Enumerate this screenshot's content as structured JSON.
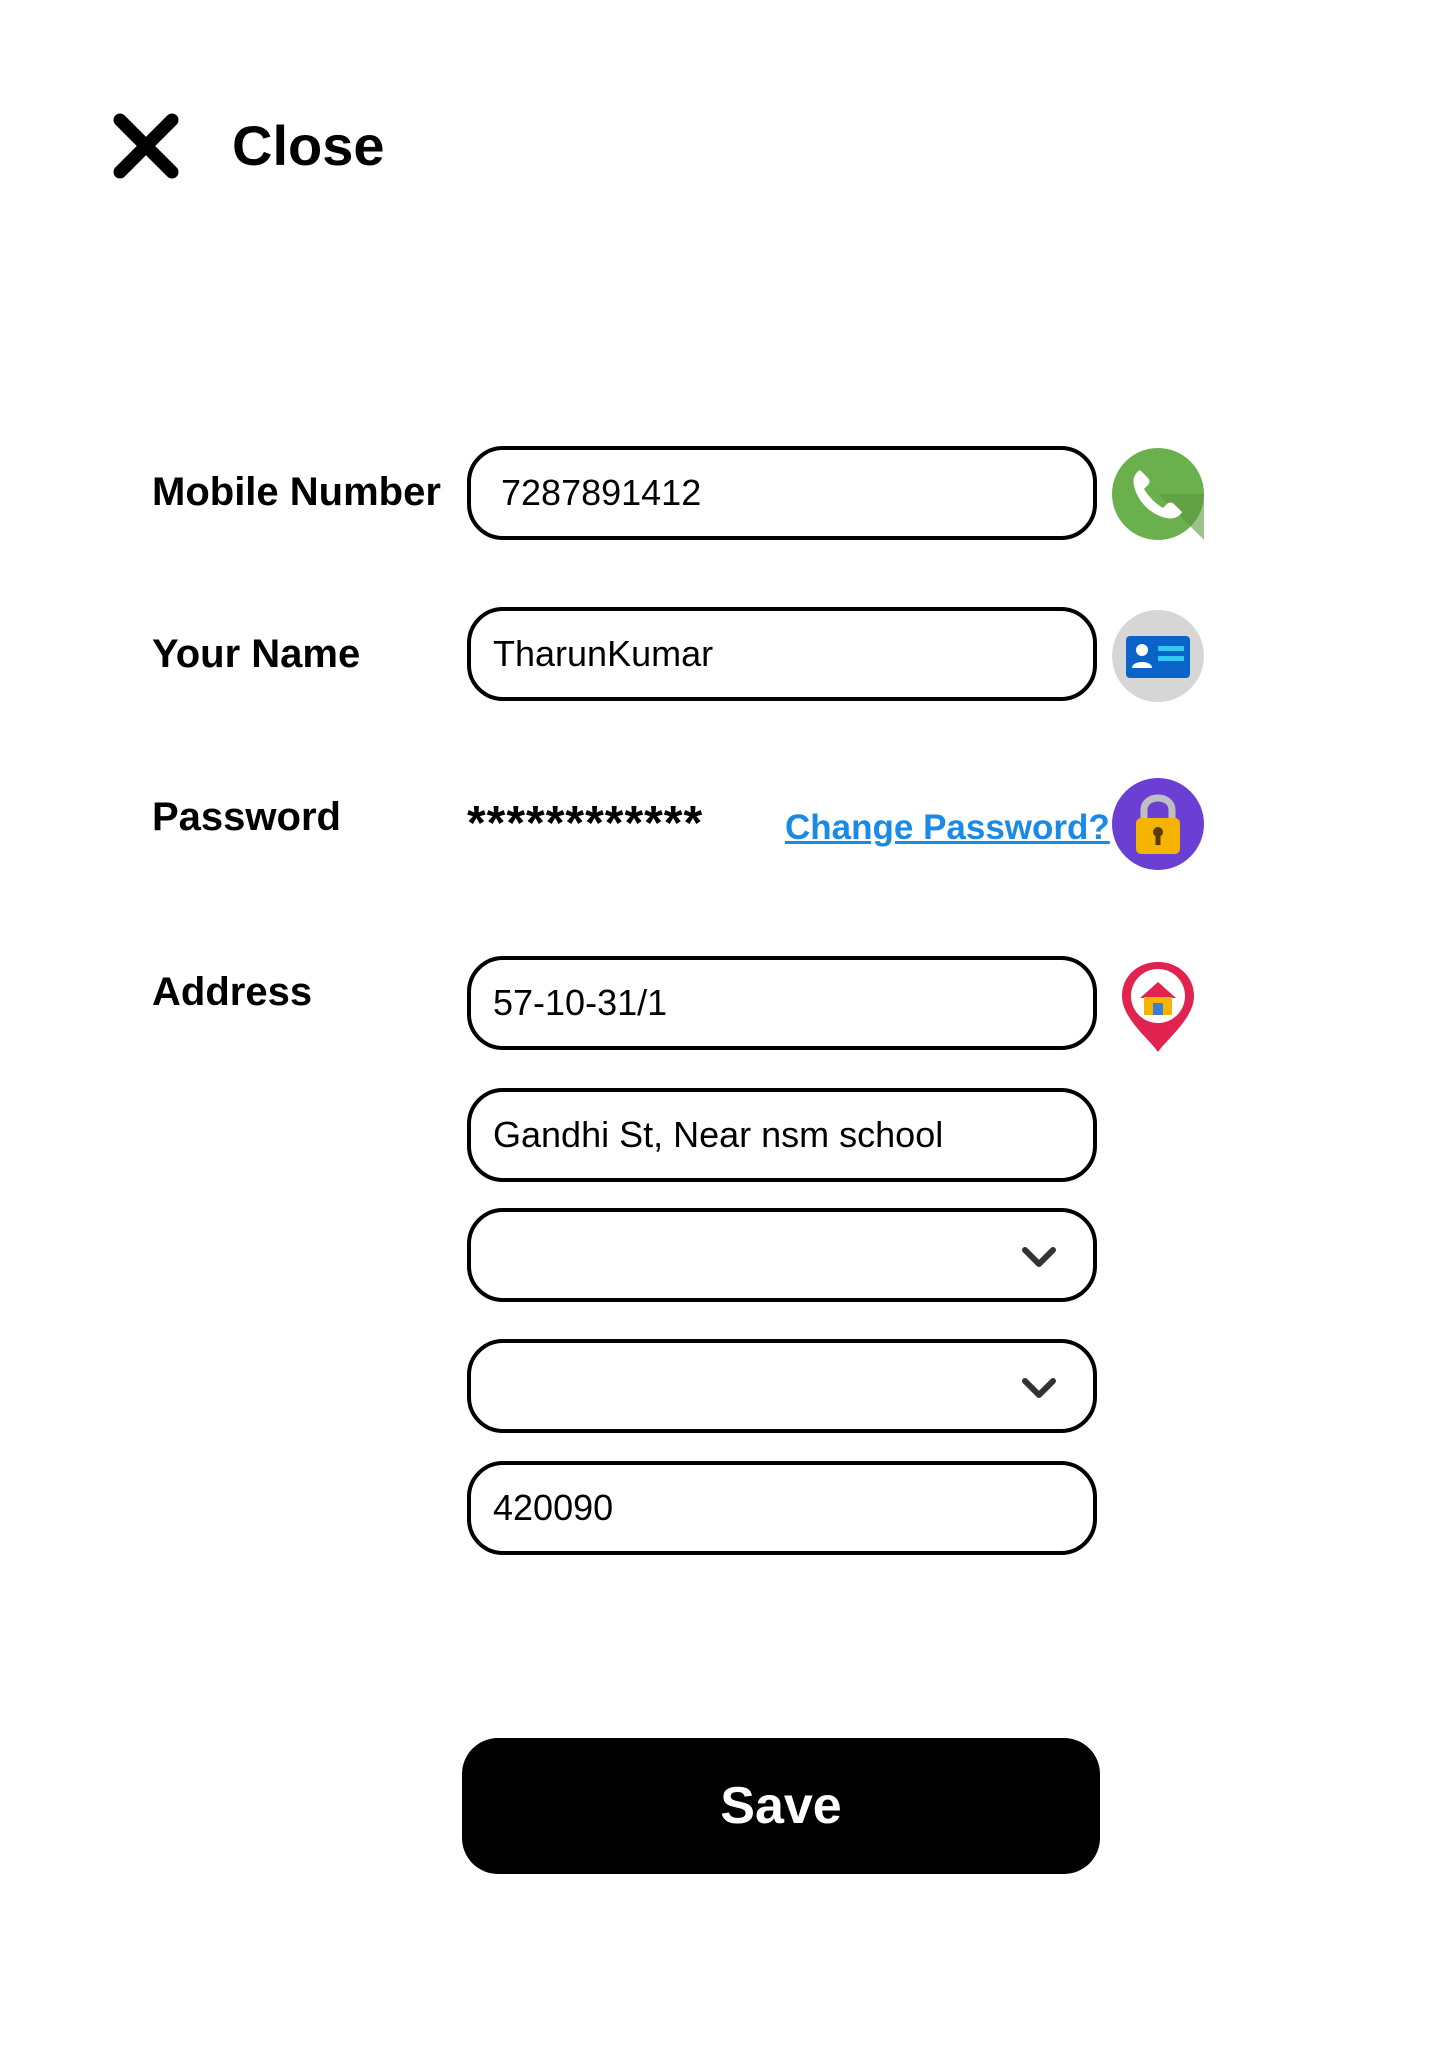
{
  "header": {
    "close_label": "Close"
  },
  "form": {
    "mobile": {
      "label": "Mobile Number",
      "value": "7287891412",
      "icon": "phone-icon"
    },
    "name": {
      "label": "Your Name",
      "value": "TharunKumar",
      "icon": "id-card-icon"
    },
    "password": {
      "label": "Password",
      "masked_value": "************",
      "change_link": "Change Password?",
      "icon": "lock-icon"
    },
    "address": {
      "label": "Address",
      "icon": "home-location-icon",
      "line1": "57-10-31/1",
      "line2": "Gandhi St, Near nsm school",
      "dropdown1_value": "",
      "dropdown2_value": "",
      "pincode": "420090"
    }
  },
  "actions": {
    "save_label": "Save"
  },
  "colors": {
    "link": "#1a8ae6",
    "phone_green": "#6ab04c",
    "lock_purple": "#6b3fd4",
    "lock_yellow": "#f5b400",
    "pin_red": "#e0244f"
  }
}
